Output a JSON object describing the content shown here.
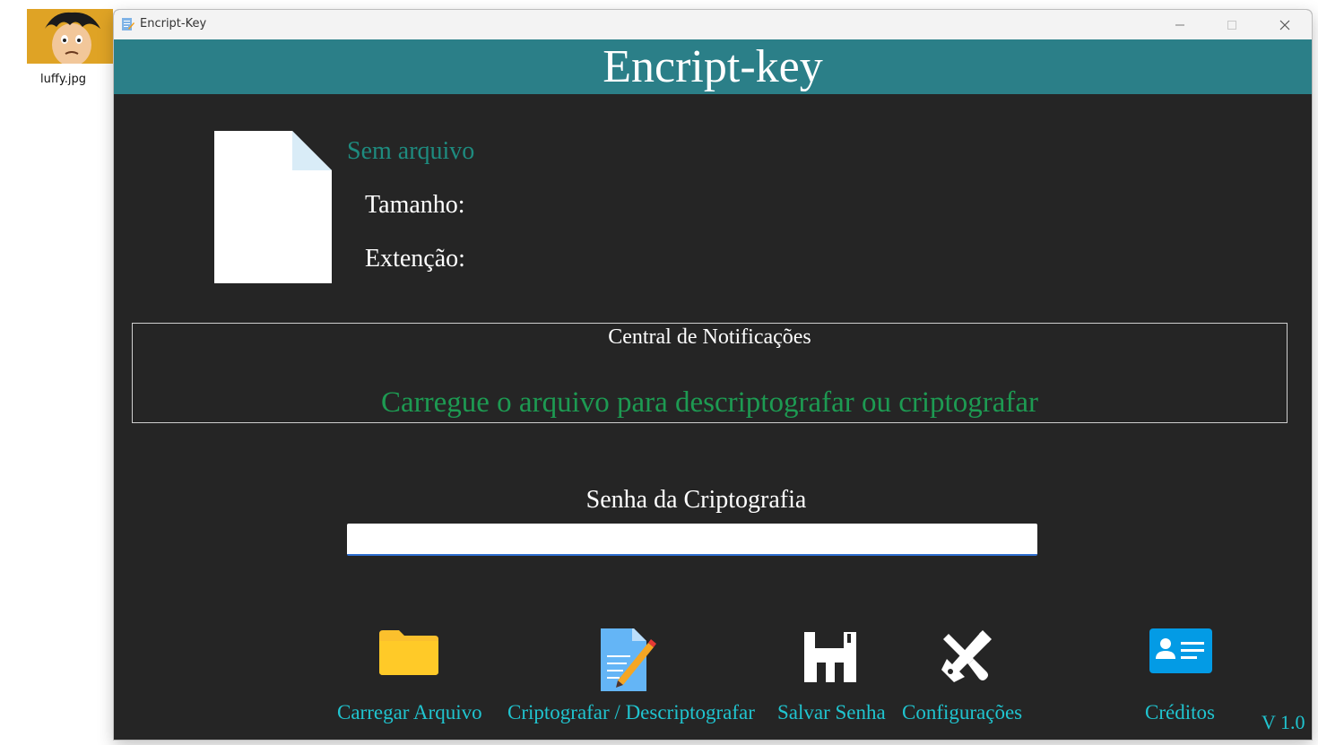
{
  "desktop": {
    "file_label": "luffy.jpg"
  },
  "window": {
    "title": "Encript-Key"
  },
  "app": {
    "heading": "Encript-key",
    "file_name": "Sem arquivo",
    "size_label": "Tamanho:",
    "extension_label": "Extenção:"
  },
  "notifications": {
    "title": "Central de Notificações",
    "message": "Carregue o arquivo para descriptografar ou criptografar"
  },
  "password": {
    "label": "Senha da Criptografia",
    "value": ""
  },
  "actions": {
    "load": "Carregar Arquivo",
    "crypt": "Criptografar / Descriptografar",
    "save": "Salvar Senha",
    "settings": "Configurações",
    "credits": "Créditos"
  },
  "version": "V 1.0",
  "colors": {
    "header": "#2b7f88",
    "background": "#252525",
    "accent_cyan": "#20c4cf",
    "file_name": "#1e8b7f",
    "notification": "#1d9a52"
  }
}
